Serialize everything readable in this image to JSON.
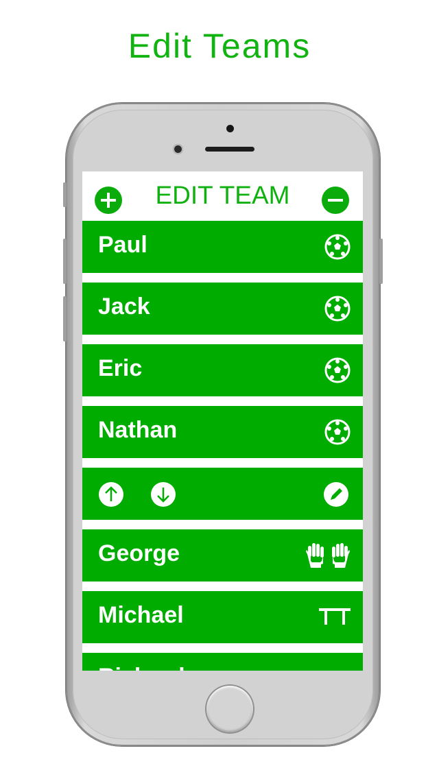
{
  "page": {
    "title": "Edit Teams"
  },
  "screen": {
    "header": {
      "title": "EDIT TEAM",
      "add_icon": "plus-circle-icon",
      "remove_icon": "minus-circle-icon"
    },
    "players": [
      {
        "name": "Paul",
        "role_icon": "soccer-ball-icon"
      },
      {
        "name": "Jack",
        "role_icon": "soccer-ball-icon"
      },
      {
        "name": "Eric",
        "role_icon": "soccer-ball-icon"
      },
      {
        "name": "Nathan",
        "role_icon": "soccer-ball-icon"
      }
    ],
    "controls": {
      "move_up_icon": "arrow-up-circle-icon",
      "move_down_icon": "arrow-down-circle-icon",
      "edit_icon": "pencil-circle-icon"
    },
    "more_players": [
      {
        "name": "George",
        "role_icon": "goalkeeper-gloves-icon"
      },
      {
        "name": "Michael",
        "role_icon": "substitutes-bench-icon"
      },
      {
        "name": "Richard",
        "role_icon": ""
      }
    ]
  },
  "colors": {
    "accent": "#00ac00",
    "title": "#11b311",
    "background": "#ffffff"
  }
}
